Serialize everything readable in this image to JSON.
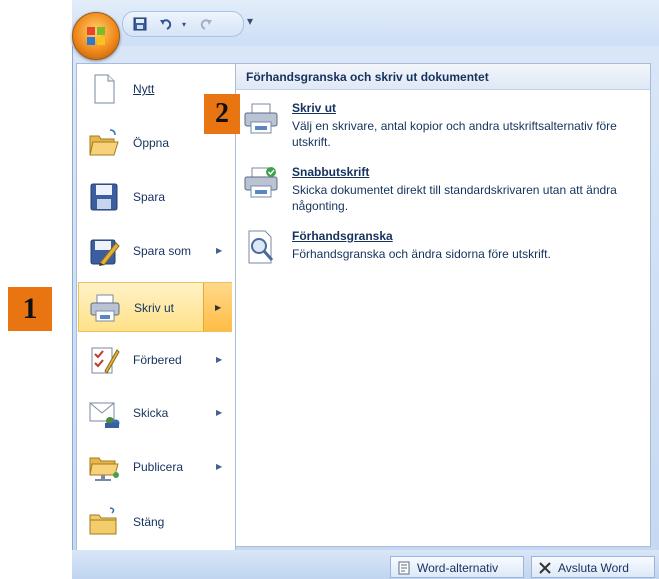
{
  "qat": {
    "save_icon": "save-icon",
    "undo_icon": "undo-icon",
    "redo_icon": "redo-icon",
    "customize_glyph": "▾"
  },
  "left_menu": [
    {
      "key": "nytt",
      "label": "Nytt",
      "icon": "new-document-icon",
      "has_submenu": false
    },
    {
      "key": "oppna",
      "label": "Öppna",
      "icon": "open-folder-icon",
      "has_submenu": false
    },
    {
      "key": "spara",
      "label": "Spara",
      "icon": "save-disk-icon",
      "has_submenu": false
    },
    {
      "key": "spara-som",
      "label": "Spara som",
      "icon": "save-as-icon",
      "has_submenu": true
    },
    {
      "key": "skriv-ut",
      "label": "Skriv ut",
      "icon": "printer-icon",
      "has_submenu": true,
      "active": true
    },
    {
      "key": "forbered",
      "label": "Förbered",
      "icon": "prepare-icon",
      "has_submenu": true
    },
    {
      "key": "skicka",
      "label": "Skicka",
      "icon": "send-icon",
      "has_submenu": true
    },
    {
      "key": "publicera",
      "label": "Publicera",
      "icon": "publish-icon",
      "has_submenu": true
    },
    {
      "key": "stang",
      "label": "Stäng",
      "icon": "close-folder-icon",
      "has_submenu": false
    }
  ],
  "submenu": {
    "header": "Förhandsgranska och skriv ut dokumentet",
    "items": [
      {
        "title": "Skriv ut",
        "desc": "Välj en skrivare, antal kopior och andra utskriftsalternativ före utskrift."
      },
      {
        "title": "Snabbutskrift",
        "desc": "Skicka dokumentet direkt till standardskrivaren utan att ändra någonting."
      },
      {
        "title": "Förhandsgranska",
        "desc": "Förhandsgranska och ändra sidorna före utskrift."
      }
    ]
  },
  "bottom": {
    "options_label": "Word-alternativ",
    "exit_label": "Avsluta Word"
  },
  "badges": {
    "step1": "1",
    "step2": "2"
  },
  "colors": {
    "badge": "#e87511",
    "active_highlight": "#ffe189",
    "text": "#15325d"
  }
}
